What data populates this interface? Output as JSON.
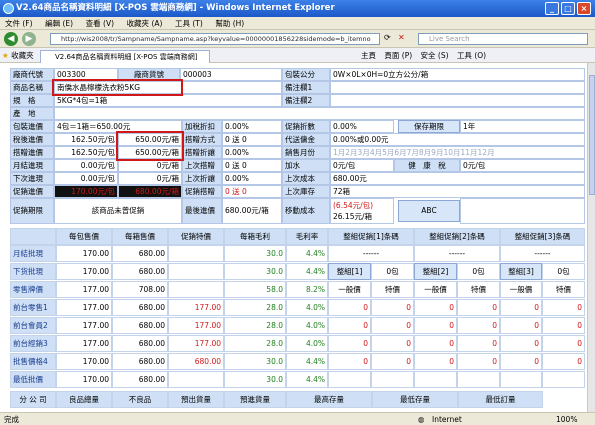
{
  "window": {
    "title": "V2.64商品名稱資料明細 [X-POS 雲端商務網] - Windows Internet Explorer"
  },
  "menu": [
    "文件 (F)",
    "編輯 (E)",
    "查看 (V)",
    "收藏夾 (A)",
    "工具 (T)",
    "幫助 (H)"
  ],
  "addr": {
    "url": "http://wis2008/tr/Sampname/Sampname.asp?keyvalue=00000001856228sidemode=b_itemno",
    "search": "Live Search"
  },
  "favbar": {
    "fav": "收藏夾",
    "tab": "V2.64商品名稱資料明細 [X-POS 雲端商務網]",
    "tools": [
      "主頁",
      "頁面 (P)",
      "安全 (S)",
      "工具 (O)"
    ]
  },
  "colors": {
    "accent": "#cfe0f6",
    "red": "#d01818",
    "green": "#208020"
  },
  "rows": {
    "vendor_code": "廠商代號",
    "vendor_code_val": "003300",
    "vendor_no": "廠商貨號",
    "vendor_no_val": "000003",
    "pack": "包裝公分",
    "pack_val": "0W×0L×0H=0立方公分/箱",
    "name": "商品名稱",
    "name_val": "南僑水晶檸檬洗衣粉5KG",
    "note1": "備注欄1",
    "spec": "規　格",
    "spec_val": "5KG*4包=1箱",
    "note2": "備注欄2",
    "origin": "產　地",
    "pack_qty": "包裝進價",
    "pack_qty_val": "4包＝1箱＝650.00元",
    "tax_deduct": "加稅折扣",
    "tax_deduct_val": "0.00%",
    "promo_discount": "促銷折數",
    "promo_discount_val": "0.00%",
    "shelf_life_btn": "保存期限",
    "shelf_life_val": "1年",
    "tax_cost": "稅後進價",
    "tax_cost_val1": "162.50元/包",
    "tax_cost_val2": "650.00元/箱",
    "gift_mode": "搭贈方式",
    "gift_mode_val": "0 送 0",
    "agent_fee": "代送傭金",
    "agent_fee_val": "0.00%或0.00元",
    "gift_cost": "搭贈進價",
    "gift_cost_val1": "162.50元/包",
    "gift_cost_val2": "650.00元/箱",
    "gift_rule": "搭贈折讓",
    "gift_rule_val": "0.00%",
    "sales_month": "銷售月份",
    "sales_month_val": "1月2月3月4月5月6月7月8月9月10月11月12月",
    "month_cost": "月結進現",
    "month_cost_val": "0.00元/包",
    "month_cost_val2": "0元/箱",
    "last_gift": "上次搭贈",
    "last_gift_val": "0 送 0",
    "add_water": "加水",
    "add_water_val": "0元/包",
    "health_tax": "健　康　稅",
    "health_tax_val": "0元/包",
    "next_cost": "下次進現",
    "next_cost_val": "0.00元/包",
    "next_cost_val2": "0元/箱",
    "last_rule": "上次折讓",
    "last_rule_val": "0.00%",
    "last_cost": "上次成本",
    "last_cost_val": "680.00元",
    "promo_cost": "促銷進價",
    "promo_cost_val": "170.00元/包",
    "promo_cost_val2": "680.00元/箱",
    "promo_gift": "促銷搭贈",
    "promo_gift_val": "0 送 0",
    "last_stock": "上次庫存",
    "last_stock_val": "72箱",
    "promo_period": "促銷期限",
    "promo_period_val": "該商品未曾促銷",
    "latest_cost": "最後進價",
    "latest_cost_val": "680.00元/箱",
    "moving_cost": "移動成本",
    "moving_cost_val1": "(6.54元/包)",
    "moving_cost_val2": "26.15元/箱",
    "abc": "ABC"
  },
  "grid": {
    "headers": [
      "每包售價",
      "每箱售價",
      "促銷特價",
      "每箱毛利",
      "毛利率",
      "整組促銷[1]条碼",
      "整組促銷[2]条碼",
      "整組促銷[3]条碼"
    ],
    "rows": [
      {
        "label": "月結批現",
        "c1": "170.00",
        "c2": "680.00",
        "c3": "",
        "c4": "30.0",
        "c5": "4.4%",
        "e1": "------",
        "e2": "------",
        "e3": "------"
      },
      {
        "label": "下货批現",
        "c1": "170.00",
        "c2": "680.00",
        "c3": "",
        "c4": "30.0",
        "c5": "4.4%",
        "e1": "整組[1]",
        "e1b": "0包",
        "e2": "整組[2]",
        "e2b": "0包",
        "e3": "整組[3]",
        "e3b": "0包"
      },
      {
        "label": "零售牌價",
        "c1": "177.00",
        "c2": "708.00",
        "c3": "",
        "c4": "58.0",
        "c5": "8.2%",
        "e1": "一般價",
        "e1b": "特價",
        "e2": "一般價",
        "e2b": "特價",
        "e3": "一般價",
        "e3b": "特價"
      },
      {
        "label": "前台零售1",
        "c1": "177.00",
        "c2": "680.00",
        "c3": "177.00",
        "c4": "28.0",
        "c5": "4.0%",
        "e1": "0",
        "e1b": "0",
        "e2": "0",
        "e2b": "0",
        "e3": "0",
        "e3b": "0"
      },
      {
        "label": "前台會員2",
        "c1": "177.00",
        "c2": "680.00",
        "c3": "177.00",
        "c4": "28.0",
        "c5": "4.0%",
        "e1": "0",
        "e1b": "0",
        "e2": "0",
        "e2b": "0",
        "e3": "0",
        "e3b": "0"
      },
      {
        "label": "前台經銷3",
        "c1": "177.00",
        "c2": "680.00",
        "c3": "177.00",
        "c4": "28.0",
        "c5": "4.0%",
        "e1": "0",
        "e1b": "0",
        "e2": "0",
        "e2b": "0",
        "e3": "0",
        "e3b": "0"
      },
      {
        "label": "批售價格4",
        "c1": "170.00",
        "c2": "680.00",
        "c3": "680.00",
        "c4": "30.0",
        "c5": "4.4%",
        "e1": "0",
        "e1b": "0",
        "e2": "0",
        "e2b": "0",
        "e3": "0",
        "e3b": "0"
      },
      {
        "label": "最低批價",
        "c1": "170.00",
        "c2": "680.00",
        "c3": "",
        "c4": "30.0",
        "c5": "4.4%",
        "e1": "",
        "e1b": "",
        "e2": "",
        "e2b": "",
        "e3": "",
        "e3b": ""
      }
    ],
    "footer": [
      "分 公 司",
      "良品總量",
      "不良品",
      "預出貨量",
      "預進貨量",
      "最高存量",
      "最低存量",
      "最低訂量"
    ]
  },
  "status": {
    "left": "完成",
    "zone": "Internet",
    "zoom": "100%"
  }
}
